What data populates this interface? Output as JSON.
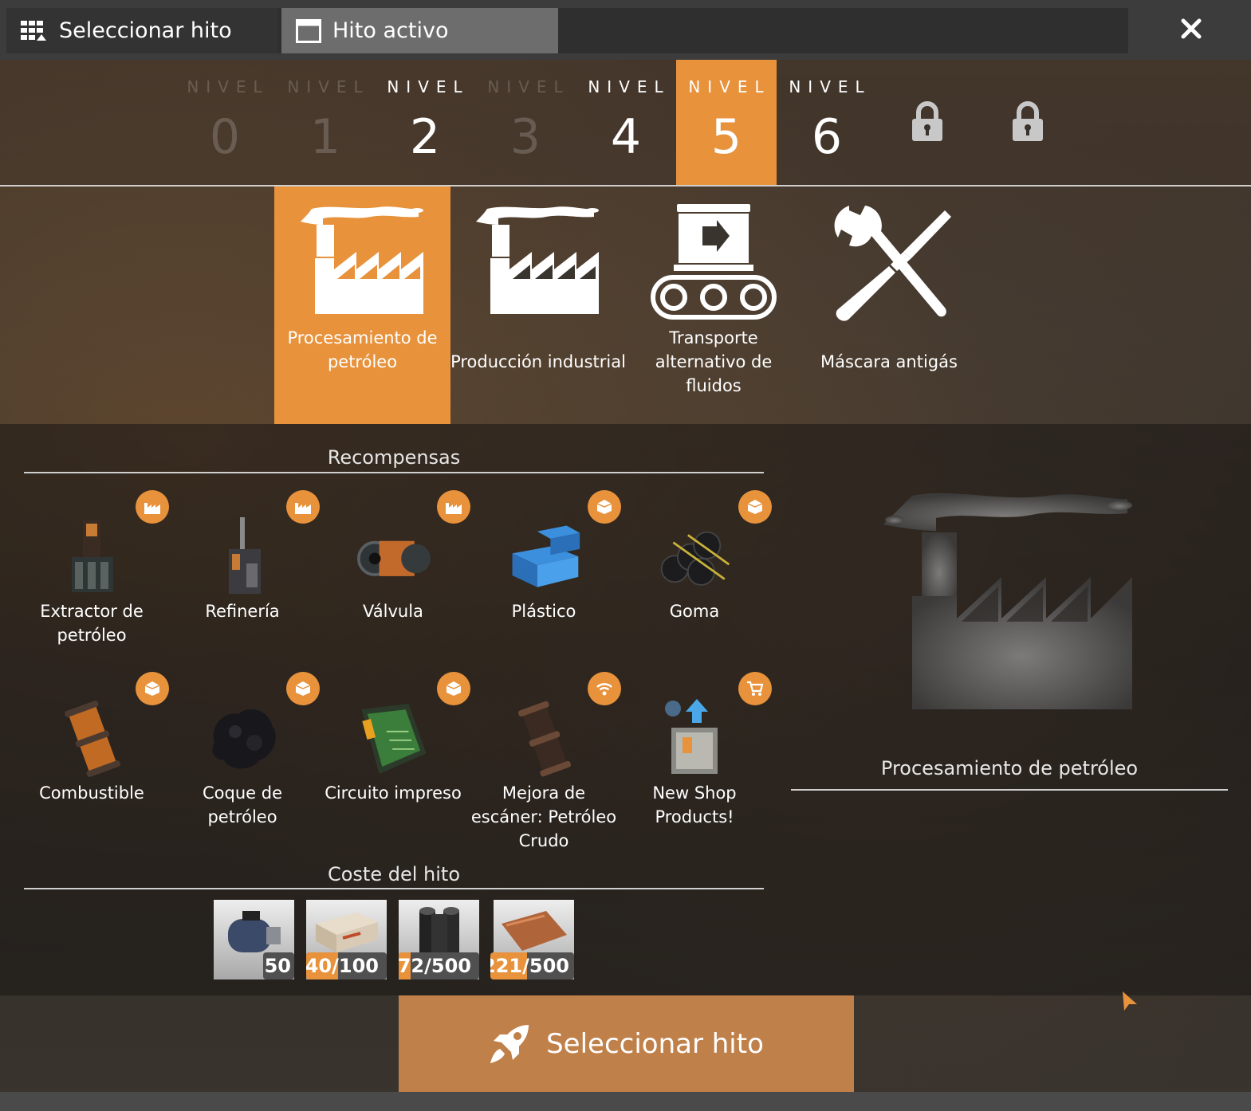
{
  "tabs": [
    {
      "label": "Seleccionar hito",
      "icon": "grid-icon"
    },
    {
      "label": "Hito activo",
      "icon": "window-icon"
    }
  ],
  "levels": [
    {
      "label": "NIVEL",
      "number": "0",
      "state": "dim"
    },
    {
      "label": "NIVEL",
      "number": "1",
      "state": "dim"
    },
    {
      "label": "NIVEL",
      "number": "2",
      "state": "normal"
    },
    {
      "label": "NIVEL",
      "number": "3",
      "state": "dim"
    },
    {
      "label": "NIVEL",
      "number": "4",
      "state": "normal"
    },
    {
      "label": "NIVEL",
      "number": "5",
      "state": "active"
    },
    {
      "label": "NIVEL",
      "number": "6",
      "state": "normal"
    }
  ],
  "locked_levels": [
    "lock-icon",
    "lock-icon"
  ],
  "milestones": [
    {
      "label": "Procesamiento de petróleo",
      "icon": "factory-icon",
      "active": true
    },
    {
      "label": "Producción industrial",
      "icon": "factory-icon",
      "active": false
    },
    {
      "label": "Transporte alternativo de fluidos",
      "icon": "conveyor-icon",
      "active": false
    },
    {
      "label": "Máscara antigás",
      "icon": "tools-icon",
      "active": false
    }
  ],
  "rewards_title": "Recompensas",
  "rewards": [
    {
      "name": "Extractor de petróleo",
      "badge": "building-icon"
    },
    {
      "name": "Refinería",
      "badge": "building-icon"
    },
    {
      "name": "Válvula",
      "badge": "building-icon"
    },
    {
      "name": "Plástico",
      "badge": "item-icon"
    },
    {
      "name": "Goma",
      "badge": "item-icon"
    },
    {
      "name": "Combustible",
      "badge": "item-icon"
    },
    {
      "name": "Coque de petróleo",
      "badge": "item-icon"
    },
    {
      "name": "Circuito impreso",
      "badge": "item-icon"
    },
    {
      "name": "Mejora de escáner: Petróleo Crudo",
      "badge": "wifi-icon"
    },
    {
      "name": "New Shop Products!",
      "badge": "cart-icon"
    }
  ],
  "cost_title": "Coste del hito",
  "costs": [
    {
      "amount": "50",
      "progress": 1.0
    },
    {
      "amount": "40/100",
      "progress": 0.4
    },
    {
      "amount": "72/500",
      "progress": 0.144
    },
    {
      "amount": "221/500",
      "progress": 0.442
    }
  ],
  "preview_title": "Procesamiento de petróleo",
  "select_button": "Seleccionar hito",
  "colors": {
    "accent": "#e8923c",
    "button": "#c0804a"
  }
}
